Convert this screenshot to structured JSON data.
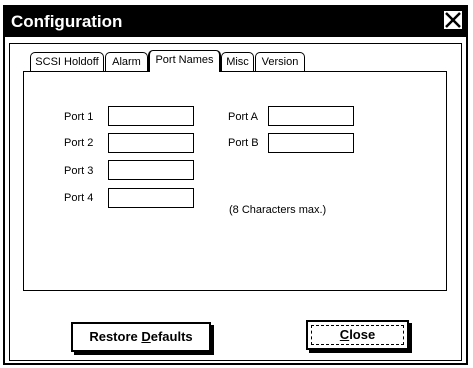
{
  "window": {
    "title": "Configuration",
    "close_icon": "close-icon"
  },
  "tabs": [
    {
      "label": "SCSI Holdoff",
      "active": false
    },
    {
      "label": "Alarm",
      "active": false
    },
    {
      "label": "Port Names",
      "active": true
    },
    {
      "label": "Misc",
      "active": false
    },
    {
      "label": "Version",
      "active": false
    }
  ],
  "ports": {
    "left": [
      {
        "label": "Port 1",
        "value": ""
      },
      {
        "label": "Port 2",
        "value": ""
      },
      {
        "label": "Port 3",
        "value": ""
      },
      {
        "label": "Port 4",
        "value": ""
      }
    ],
    "right": [
      {
        "label": "Port A",
        "value": ""
      },
      {
        "label": "Port B",
        "value": ""
      }
    ],
    "note": "(8 Characters max.)"
  },
  "buttons": {
    "restore": {
      "before": "Restore ",
      "accel": "D",
      "after": "efaults"
    },
    "close": {
      "before": "",
      "accel": "C",
      "after": "lose"
    }
  }
}
